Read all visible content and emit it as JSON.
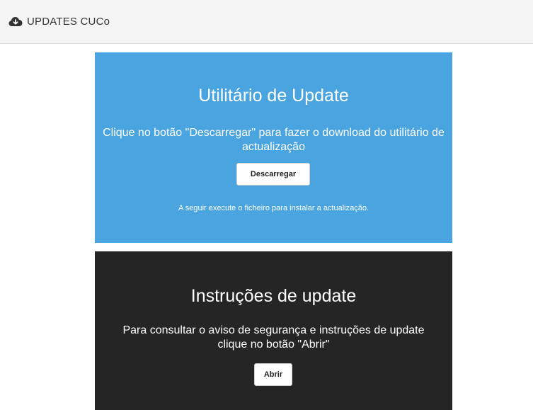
{
  "header": {
    "icon": "cloud-download-icon",
    "title": "UPDATES CUCo"
  },
  "utility_panel": {
    "background": "#4aa4e0",
    "title": "Utilitário de Update",
    "description": "Clique no botão \"Descarregar\" para fazer o download do utilitário de actualização",
    "button_label": "Descarregar",
    "note": "A seguir execute o ficheiro para instalar a actualização."
  },
  "instructions_panel": {
    "background": "#252525",
    "title": "Instruções de update",
    "description": "Para consultar o aviso de segurança e instruções de update clique no botão \"Abrir\"",
    "button_label": "Abrir"
  }
}
